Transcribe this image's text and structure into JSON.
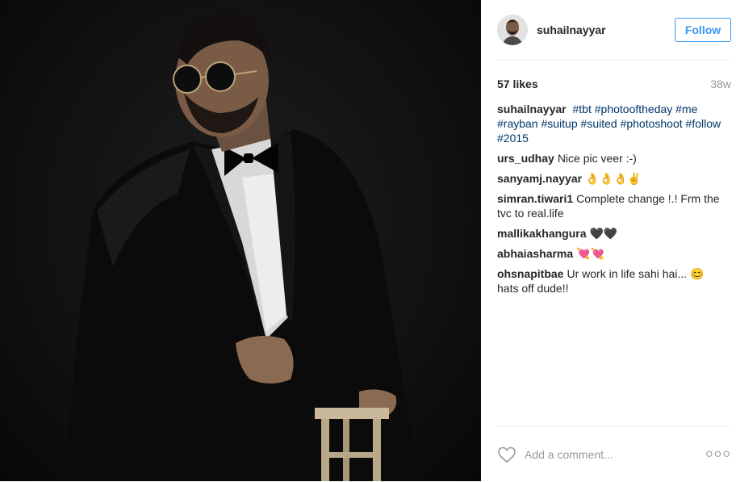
{
  "post": {
    "username": "suhailnayyar",
    "follow_label": "Follow",
    "likes": "57 likes",
    "age": "38w",
    "caption": {
      "user": "suhailnayyar",
      "tags": [
        "#tbt",
        "#photooftheday",
        "#me",
        "#rayban",
        "#suitup",
        "#suited",
        "#photoshoot",
        "#follow",
        "#2015"
      ]
    },
    "comments": [
      {
        "user": "urs_udhay",
        "text": "Nice pic veer :-)"
      },
      {
        "user": "sanyamj.nayyar",
        "text": "👌👌👌✌"
      },
      {
        "user": "simran.tiwari1",
        "text": "Complete change !.! Frm the tvc to real.life"
      },
      {
        "user": "mallikakhangura",
        "text": "🖤🖤"
      },
      {
        "user": "abhaiasharma",
        "text": "💘💘"
      },
      {
        "user": "ohsnapitbae",
        "text": "Ur work in life sahi hai... 😊 hats off dude!!"
      }
    ],
    "add_comment_placeholder": "Add a comment...",
    "more_label": "○○○"
  },
  "icons": {
    "heart": "heart-icon",
    "more": "more-options-icon"
  },
  "colors": {
    "follow": "#3897f0",
    "hashtag": "#003569",
    "muted": "#999999"
  }
}
